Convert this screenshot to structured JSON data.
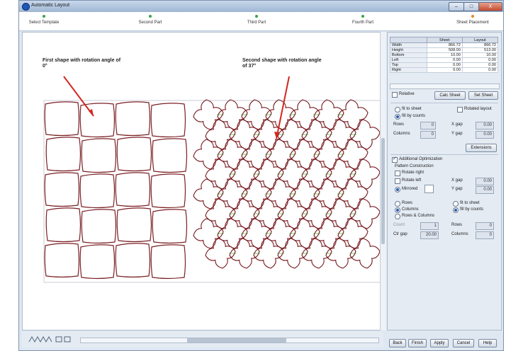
{
  "window": {
    "title": "Automatic Layout",
    "controls": {
      "minimize": "–",
      "maximize": "□",
      "close": "X"
    }
  },
  "steps": [
    {
      "label": "Select Template",
      "active": false
    },
    {
      "label": "Second Part",
      "active": false
    },
    {
      "label": "Third Part",
      "active": false
    },
    {
      "label": "Fourth Part",
      "active": false
    },
    {
      "label": "Sheet Placement",
      "active": true
    }
  ],
  "annotations": {
    "first_line1": "First shape with rotation angle of",
    "first_line2": "0°",
    "second_line1": "Second shape with rotation angle",
    "second_line2": "of 37°"
  },
  "colors": {
    "shape_outline": "#7a1f24",
    "connector": "#6fd66f",
    "arrow": "#d4261f"
  },
  "properties": {
    "headers": [
      "",
      "Sheet",
      "Layout"
    ],
    "rows": [
      {
        "key": "Width",
        "sheet": "866.72",
        "layout": "866.72"
      },
      {
        "key": "Height",
        "sheet": "508.00",
        "layout": "513.00"
      },
      {
        "key": "Bottom",
        "sheet": "10.00",
        "layout": "10.00"
      },
      {
        "key": "Left",
        "sheet": "0.00",
        "layout": "0.00"
      },
      {
        "key": "Top",
        "sheet": "0.00",
        "layout": "0.00"
      },
      {
        "key": "Right",
        "sheet": "0.00",
        "layout": "0.00"
      }
    ]
  },
  "panel": {
    "relative_label": "Relative",
    "calc_sheet": "Calc Sheet",
    "set_sheet": "Set Sheet",
    "fit_in_sheet": "fit to sheet",
    "fill_by_counts": "fill by counts",
    "rotated_layout": "Rotated layout",
    "rows_label": "Rows",
    "rows_value": "0",
    "columns_label": "Columns",
    "columns_value": "0",
    "x_gap_label": "X gap",
    "x_gap_value": "0.00",
    "y_gap_label": "Y gap",
    "y_gap_value": "0.00",
    "extensions": "Extensions",
    "additional_optimization": "Additional Optimization",
    "pattern_construction": "Pattern Construction",
    "rotate_right": "Rotate right",
    "rotate_left": "Rotate left",
    "mirrored": "Mirrored",
    "x_gap2_value": "0.00",
    "y_gap2_value": "0.00",
    "rows2": "Rows",
    "columns2": "Columns",
    "rows_and_columns": "Rows & Columns",
    "fit_in_sheet2": "fit to sheet",
    "fill_by_counts2": "fill by counts",
    "count_label": "Count",
    "count_value": "1",
    "rows3_label": "Rows",
    "rows3_value": "0",
    "ctr_gap_label": "Ctr gap",
    "ctr_gap_value": "20.00",
    "columns3_label": "Columns",
    "columns3_value": "0"
  },
  "footer_buttons": {
    "back": "Back",
    "finish": "Finish",
    "apply": "Apply",
    "cancel": "Cancel",
    "help": "Help"
  }
}
